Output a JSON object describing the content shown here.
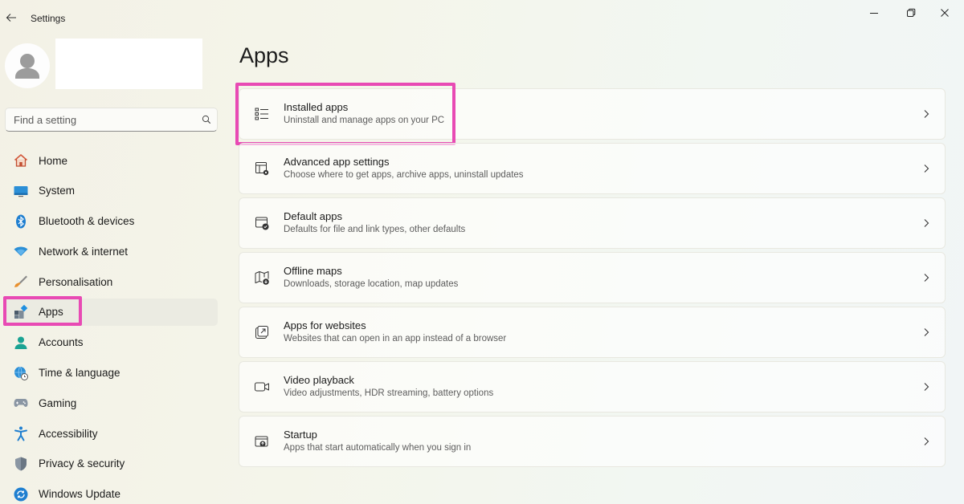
{
  "window": {
    "title": "Settings",
    "back_icon": "back-arrow-icon",
    "minimize_icon": "minimize-icon",
    "maximize_icon": "restore-icon",
    "close_icon": "close-icon"
  },
  "sidebar": {
    "search": {
      "placeholder": "Find a setting",
      "icon": "search-icon"
    },
    "items": [
      {
        "label": "Home",
        "icon": "home-icon"
      },
      {
        "label": "System",
        "icon": "system-monitor-icon"
      },
      {
        "label": "Bluetooth & devices",
        "icon": "bluetooth-icon"
      },
      {
        "label": "Network & internet",
        "icon": "wifi-icon"
      },
      {
        "label": "Personalisation",
        "icon": "brush-icon"
      },
      {
        "label": "Apps",
        "icon": "apps-icon",
        "selected": true
      },
      {
        "label": "Accounts",
        "icon": "account-icon"
      },
      {
        "label": "Time & language",
        "icon": "globe-clock-icon"
      },
      {
        "label": "Gaming",
        "icon": "gamepad-icon"
      },
      {
        "label": "Accessibility",
        "icon": "accessibility-icon"
      },
      {
        "label": "Privacy & security",
        "icon": "shield-icon"
      },
      {
        "label": "Windows Update",
        "icon": "update-icon"
      }
    ]
  },
  "main": {
    "title": "Apps",
    "cards": [
      {
        "title": "Installed apps",
        "description": "Uninstall and manage apps on your PC",
        "icon": "list-icon"
      },
      {
        "title": "Advanced app settings",
        "description": "Choose where to get apps, archive apps, uninstall updates",
        "icon": "app-settings-icon"
      },
      {
        "title": "Default apps",
        "description": "Defaults for file and link types, other defaults",
        "icon": "default-apps-icon"
      },
      {
        "title": "Offline maps",
        "description": "Downloads, storage location, map updates",
        "icon": "map-download-icon"
      },
      {
        "title": "Apps for websites",
        "description": "Websites that can open in an app instead of a browser",
        "icon": "open-in-app-icon"
      },
      {
        "title": "Video playback",
        "description": "Video adjustments, HDR streaming, battery options",
        "icon": "video-icon"
      },
      {
        "title": "Startup",
        "description": "Apps that start automatically when you sign in",
        "icon": "startup-icon"
      }
    ]
  },
  "colors": {
    "highlight": "#e84ab4",
    "accent": "#0067c0"
  }
}
